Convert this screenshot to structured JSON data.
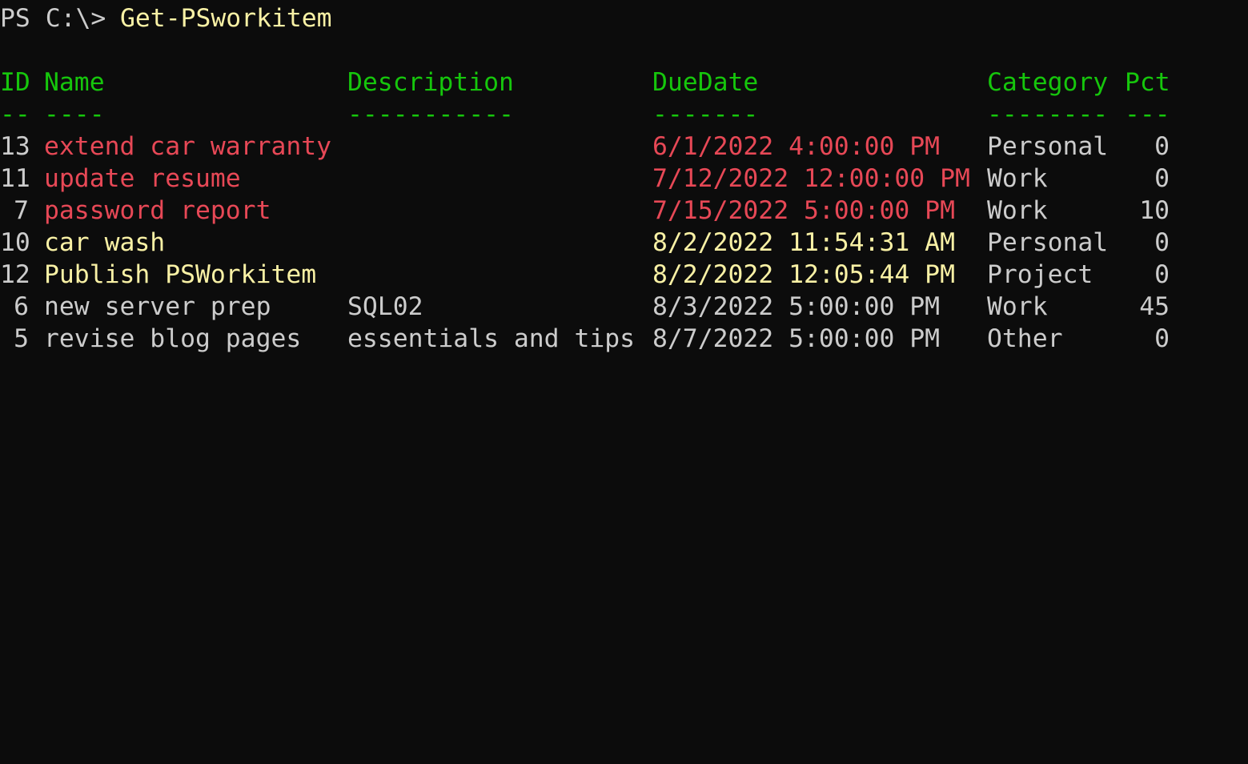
{
  "terminal": {
    "prompt": "PS C:\\> ",
    "command": "Get-PSworkitem"
  },
  "table": {
    "headers": {
      "id": "ID",
      "name": "Name",
      "description": "Description",
      "duedate": "DueDate",
      "category": "Category",
      "pct": "Pct"
    },
    "separators": {
      "id": "--",
      "name": "----",
      "description": "-----------",
      "duedate": "-------",
      "category": "--------",
      "pct": "---"
    },
    "rows": [
      {
        "id": "13",
        "name": "extend car warranty",
        "description": "",
        "duedate": "6/1/2022 4:00:00 PM",
        "category": "Personal",
        "pct": "0",
        "status": "overdue"
      },
      {
        "id": "11",
        "name": "update resume",
        "description": "",
        "duedate": "7/12/2022 12:00:00 PM",
        "category": "Work",
        "pct": "0",
        "status": "overdue"
      },
      {
        "id": "7",
        "name": "password report",
        "description": "",
        "duedate": "7/15/2022 5:00:00 PM",
        "category": "Work",
        "pct": "10",
        "status": "overdue"
      },
      {
        "id": "10",
        "name": "car wash",
        "description": "",
        "duedate": "8/2/2022 11:54:31 AM",
        "category": "Personal",
        "pct": "0",
        "status": "due-soon"
      },
      {
        "id": "12",
        "name": "Publish PSWorkitem",
        "description": "",
        "duedate": "8/2/2022 12:05:44 PM",
        "category": "Project",
        "pct": "0",
        "status": "due-soon"
      },
      {
        "id": "6",
        "name": "new server prep",
        "description": "SQL02",
        "duedate": "8/3/2022 5:00:00 PM",
        "category": "Work",
        "pct": "45",
        "status": "normal"
      },
      {
        "id": "5",
        "name": "revise blog pages",
        "description": "essentials and tips",
        "duedate": "8/7/2022 5:00:00 PM",
        "category": "Other",
        "pct": "0",
        "status": "normal"
      }
    ]
  },
  "colors": {
    "background": "#0c0c0c",
    "default_text": "#cccccc",
    "command": "#f9f1a5",
    "header": "#16c60c",
    "overdue": "#e74856",
    "due_soon": "#f9f1a5"
  }
}
